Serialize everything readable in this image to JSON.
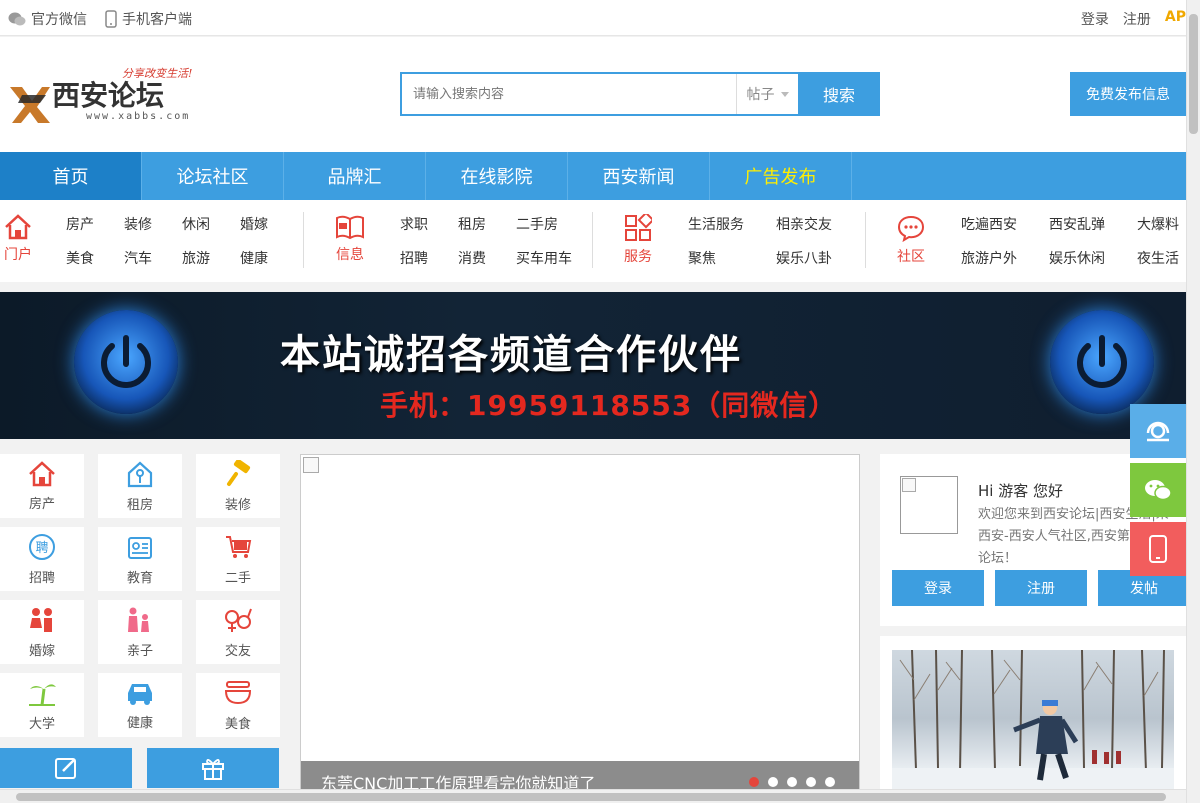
{
  "topbar": {
    "wechat": "官方微信",
    "mobile": "手机客户端",
    "login": "登录",
    "register": "注册",
    "app": "AP"
  },
  "header": {
    "logo_text": "西安论坛",
    "logo_slogan": "分享改变生活!",
    "logo_url": "www.xabbs.com",
    "search_placeholder": "请输入搜索内容",
    "search_type": "帖子",
    "search_button": "搜索",
    "publish_button": "免费发布信息"
  },
  "nav": [
    "首页",
    "论坛社区",
    "品牌汇",
    "在线影院",
    "西安新闻",
    "广告发布"
  ],
  "categories": {
    "portal": {
      "label": "门户",
      "links": [
        "房产",
        "装修",
        "休闲",
        "婚嫁",
        "美食",
        "汽车",
        "旅游",
        "健康"
      ]
    },
    "info": {
      "label": "信息",
      "links": [
        "求职",
        "租房",
        "二手房",
        "招聘",
        "消费",
        "买车用车"
      ]
    },
    "service": {
      "label": "服务",
      "links": [
        "生活服务",
        "相亲交友",
        "聚焦",
        "娱乐八卦"
      ]
    },
    "community": {
      "label": "社区",
      "links": [
        "吃遍西安",
        "西安乱弹",
        "大爆料",
        "旅游户外",
        "娱乐休闲",
        "夜生活"
      ]
    }
  },
  "banner": {
    "headline": "本站诚招各频道合作伙伴",
    "phone": "手机：19959118553（同微信）"
  },
  "icon_grid": [
    {
      "label": "房产",
      "icon": "house-icon"
    },
    {
      "label": "租房",
      "icon": "key-house-icon"
    },
    {
      "label": "装修",
      "icon": "paint-roller-icon"
    },
    {
      "label": "招聘",
      "icon": "hire-icon"
    },
    {
      "label": "教育",
      "icon": "id-card-icon"
    },
    {
      "label": "二手",
      "icon": "cart-icon"
    },
    {
      "label": "婚嫁",
      "icon": "couple-icon"
    },
    {
      "label": "亲子",
      "icon": "family-icon"
    },
    {
      "label": "交友",
      "icon": "gender-icon"
    },
    {
      "label": "大学",
      "icon": "palm-tree-icon"
    },
    {
      "label": "健康",
      "icon": "car-icon"
    },
    {
      "label": "美食",
      "icon": "bowl-icon"
    }
  ],
  "slider": {
    "caption": "东莞CNC加工工作原理看完你就知道了",
    "active_dot": 1,
    "dot_count": 5
  },
  "user_panel": {
    "greeting": "Hi 游客 您好",
    "welcome": "欢迎您来到西安论坛|西安生活|来西安-西安人气社区,西安第一门户论坛！",
    "login": "登录",
    "register": "注册",
    "post": "发帖"
  },
  "colors": {
    "accent": "#3d9ee0",
    "nav_active": "#1d80c8",
    "red": "#e5453b",
    "green": "#7ec83e",
    "ad_yellow": "#ffee00"
  }
}
